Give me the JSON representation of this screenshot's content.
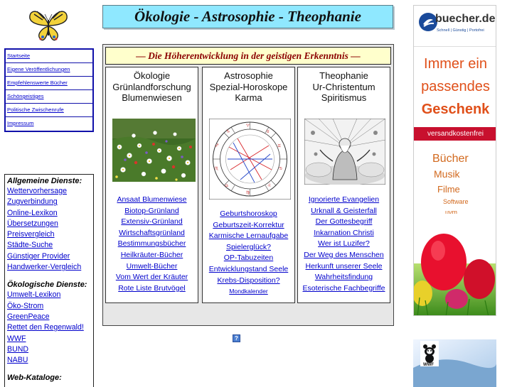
{
  "header": {
    "title": "Ökologie - Astrosophie - Theophanie"
  },
  "left_nav": {
    "items": [
      {
        "label": "Startseite"
      },
      {
        "label": "Eigene Veröffentlichungen"
      },
      {
        "label": "Empfehlenswerte Bücher"
      },
      {
        "label": "Schöngeistiges"
      },
      {
        "label": "Politische Zwischenrufe"
      },
      {
        "label": "Impressum"
      }
    ]
  },
  "services": {
    "general_heading": "Allgemeine Dienste:",
    "general": [
      "Wettervorhersage",
      "Zugverbindung",
      "Online-Lexikon",
      "Übersetzungen",
      "Preisvergleich",
      "Städte-Suche",
      "Günstiger Provider",
      "Handwerker-Vergleich"
    ],
    "eco_heading": "Ökologische Dienste:",
    "eco": [
      "Umwelt-Lexikon",
      "Öko-Strom",
      "GreenPeace",
      "Rettet den Regenwald!",
      "WWF",
      "BUND",
      "NABU"
    ],
    "web_heading": "Web-Kataloge:"
  },
  "main": {
    "subtitle": "— Die Höherentwicklung in der geistigen Erkenntnis —",
    "columns": [
      {
        "heading": [
          "Ökologie",
          "Grünlandforschung",
          "Blumenwiesen"
        ],
        "image": "flower-meadow",
        "links": [
          "Ansaat Blumenwiese",
          "Biotop-Grünland",
          "Extensiv-Grünland",
          "Wirtschaftsgrünland",
          "Bestimmungsbücher",
          "Heilkräuter-Bücher",
          "Umwelt-Bücher",
          "Vom Wert der Kräuter",
          "Rote Liste Brutvögel"
        ]
      },
      {
        "heading": [
          "Astrosophie",
          "Spezial-Horoskope",
          "Karma"
        ],
        "image": "horoscope-chart",
        "links": [
          "Geburtshoroskop",
          "Geburtszeit-Korrektur",
          "Karmische Lernaufgabe",
          "Spielerglück?",
          "OP-Tabuzeiten",
          "Entwicklungstand Seele",
          "Krebs-Disposition?"
        ],
        "small_link": "Mondkalender"
      },
      {
        "heading": [
          "Theophanie",
          "Ur-Christentum",
          "Spiritismus"
        ],
        "image": "god-engraving",
        "links": [
          "Ignorierte Evangelien",
          "Urknall & Geisterfall",
          "Der Gottesbegriff",
          "Inkarnation Christi",
          "Wer ist Luzifer?",
          "Der Weg des Menschen",
          "Herkunft unserer Seele",
          "Wahrheitsfindung",
          "Esoterische Fachbegriffe"
        ]
      }
    ],
    "help_icon": "?"
  },
  "ad": {
    "brand": "buecher.de",
    "tagline": "Schnell | Günstig | Portofrei",
    "slogan": [
      "Immer ein",
      "passendes",
      "Geschenk"
    ],
    "ribbon": "versandkostenfrei",
    "products": [
      "Bücher",
      "Musik",
      "Filme",
      "Software",
      "uvm."
    ]
  },
  "colors": {
    "title_bg": "#8fe8ff",
    "subtitle_bg": "#ffffcc",
    "subtitle_text": "#8b0000",
    "link": "#0000cc",
    "nav_border": "#1111aa",
    "ad_orange": "#e0501a",
    "ad_ribbon": "#c8102e"
  }
}
